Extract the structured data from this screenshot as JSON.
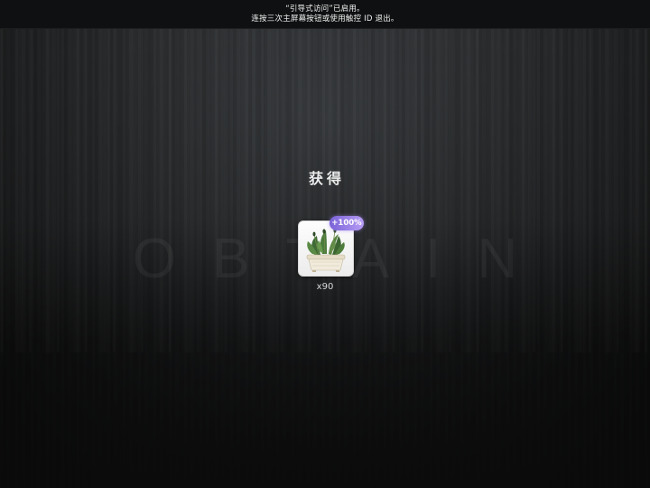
{
  "guided_access_banner": {
    "line1": "“引导式访问”已启用。",
    "line2": "连按三次主屏幕按钮或使用触控 ID 退出。"
  },
  "background_word": "OBTAIN",
  "reward_panel": {
    "title": "获得",
    "item": {
      "icon": "potted-plant-icon",
      "bonus_badge": "+100%",
      "count_label": "x90"
    }
  },
  "colors": {
    "badge_gradient_start": "#7a63d8",
    "badge_gradient_end": "#b79cf4",
    "background": "#1b1c1d"
  }
}
